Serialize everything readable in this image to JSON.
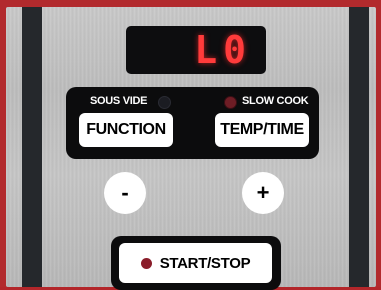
{
  "display": {
    "readout": "L0"
  },
  "modes": {
    "sous_vide_label": "SOUS VIDE",
    "slow_cook_label": "SLOW COOK"
  },
  "buttons": {
    "function_label": "FUNCTION",
    "temp_time_label": "TEMP/TIME",
    "minus_label": "-",
    "plus_label": "+",
    "start_stop_label": "START/STOP"
  },
  "colors": {
    "frame_red": "#b22a2d",
    "display_red": "#ff3b3b",
    "slow_cook_led": "#6e1d25",
    "start_led": "#8a1d2a"
  }
}
